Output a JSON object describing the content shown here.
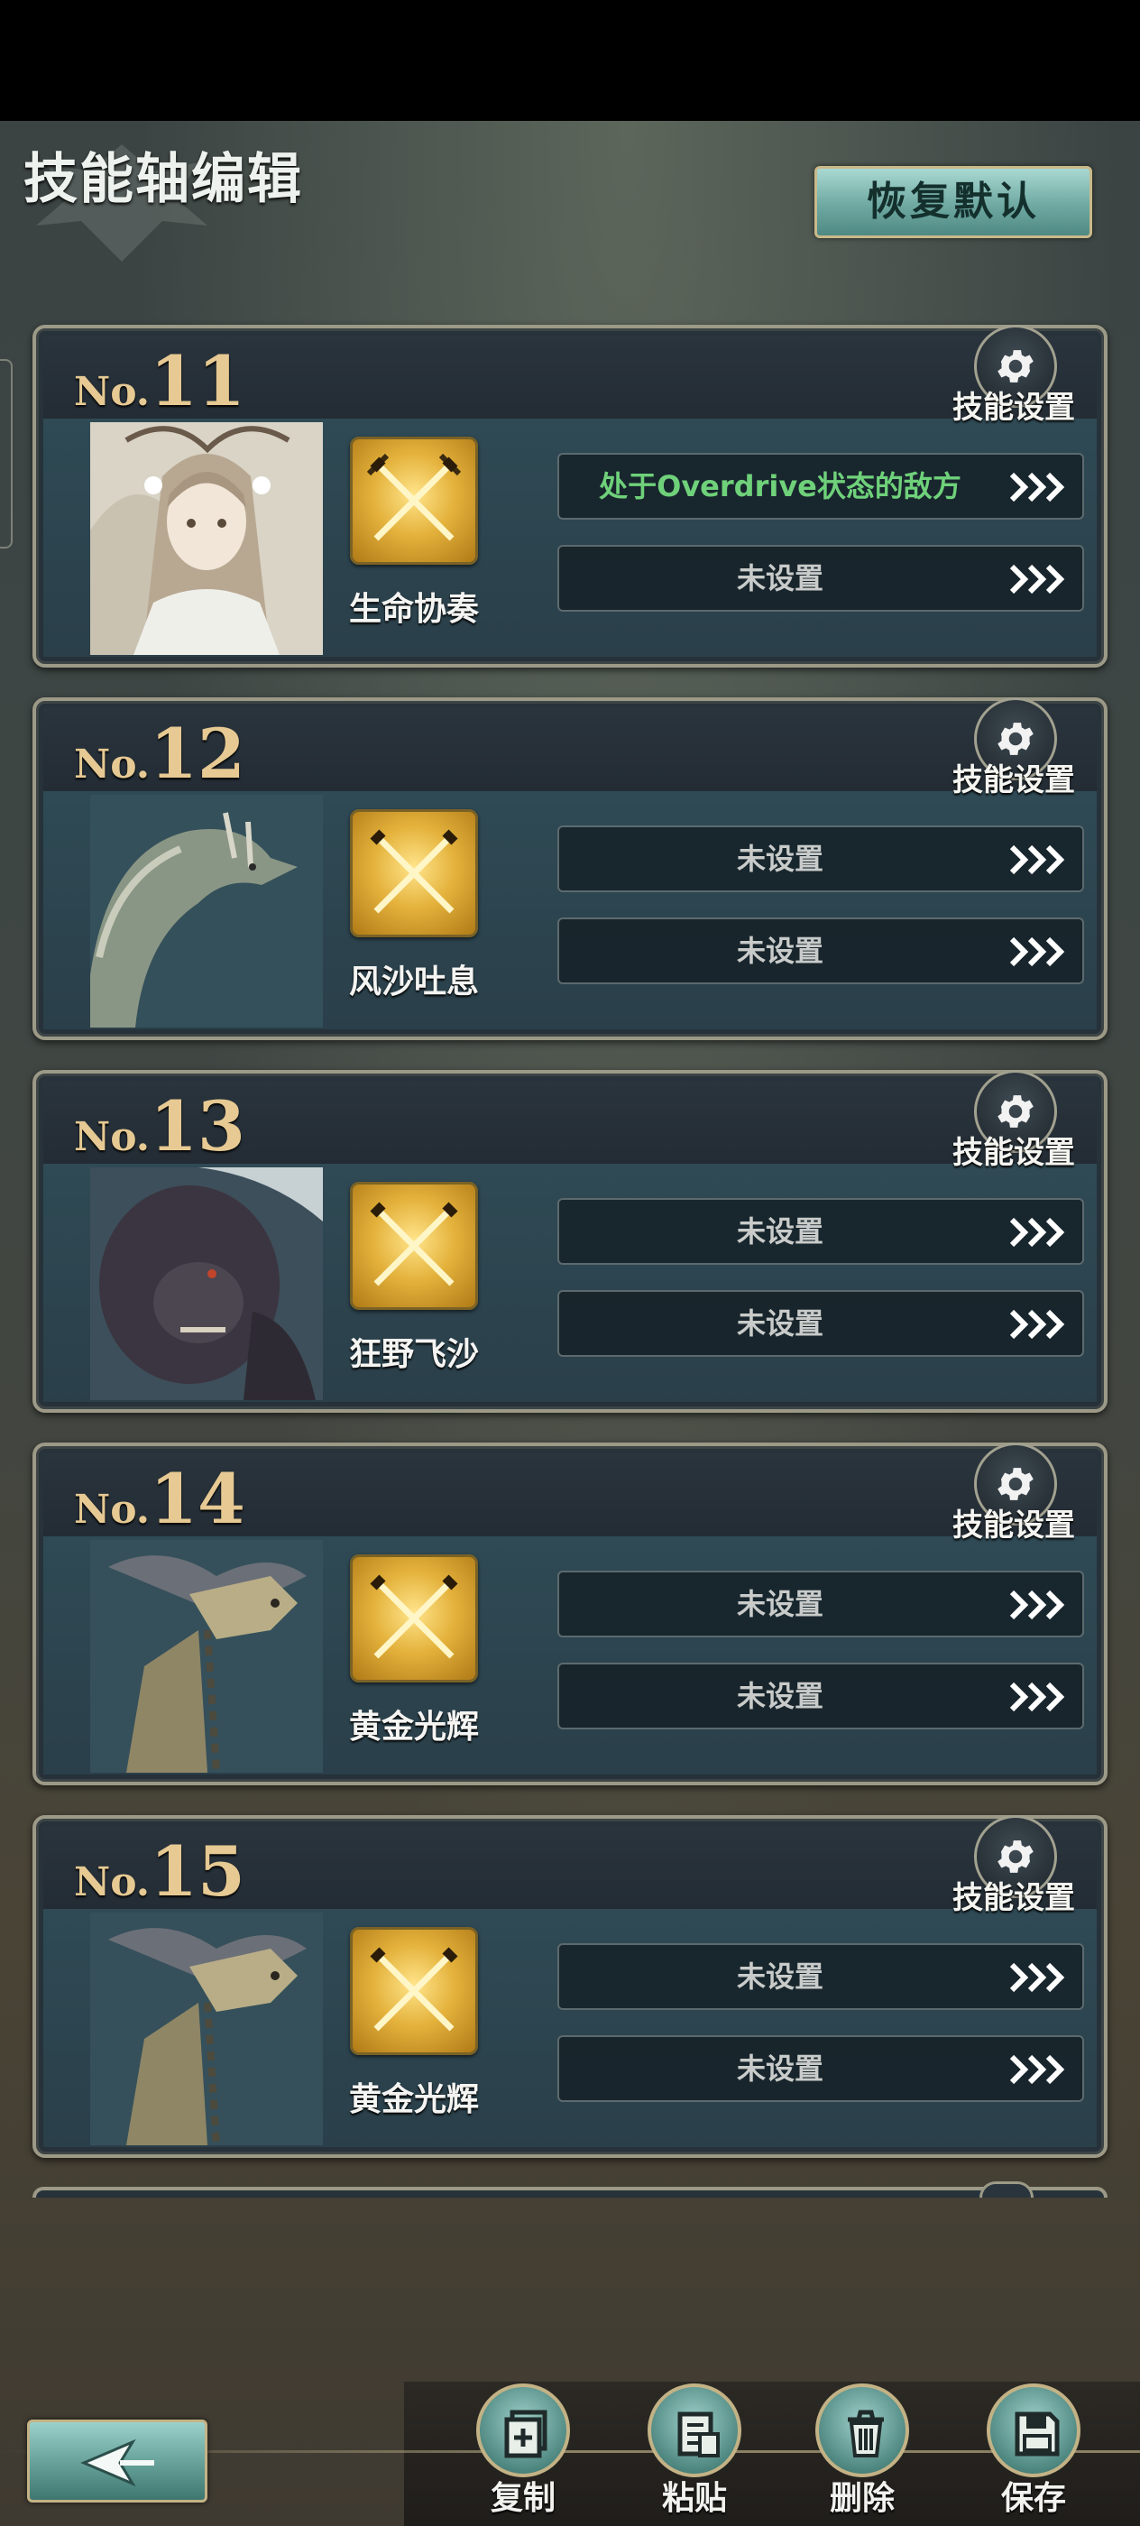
{
  "header": {
    "title": "技能轴编辑",
    "restore_default": "恢复默认"
  },
  "cards": [
    {
      "prefix": "No.",
      "number": "11",
      "settings_label": "技能设置",
      "skill_name": "生命协奏",
      "portrait": "priestess-portrait",
      "slot1": "处于Overdrive状态的敌方",
      "slot1_active": true,
      "slot2": "未设置"
    },
    {
      "prefix": "No.",
      "number": "12",
      "settings_label": "技能设置",
      "skill_name": "风沙吐息",
      "portrait": "dragon-portrait",
      "slot1": "未设置",
      "slot1_active": false,
      "slot2": "未设置"
    },
    {
      "prefix": "No.",
      "number": "13",
      "settings_label": "技能设置",
      "skill_name": "狂野飞沙",
      "portrait": "beast-portrait",
      "slot1": "未设置",
      "slot1_active": false,
      "slot2": "未设置"
    },
    {
      "prefix": "No.",
      "number": "14",
      "settings_label": "技能设置",
      "skill_name": "黄金光辉",
      "portrait": "golem-portrait",
      "slot1": "未设置",
      "slot1_active": false,
      "slot2": "未设置"
    },
    {
      "prefix": "No.",
      "number": "15",
      "settings_label": "技能设置",
      "skill_name": "黄金光辉",
      "portrait": "golem-portrait",
      "slot1": "未设置",
      "slot1_active": false,
      "slot2": "未设置"
    }
  ],
  "toolbar": {
    "copy": "复制",
    "paste": "粘贴",
    "delete": "删除",
    "save": "保存"
  },
  "colors": {
    "accent_gold": "#e6c993",
    "active_green": "#6fd17a",
    "button_teal": "#6fa9a2",
    "skill_gold": "#e4b23c"
  }
}
